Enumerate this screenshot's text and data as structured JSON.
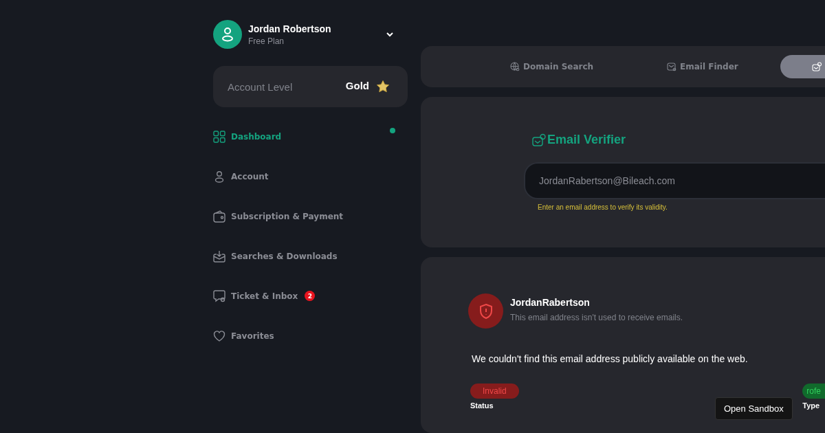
{
  "user": {
    "name": "Jordan Robertson",
    "plan": "Free Plan"
  },
  "account_level": {
    "label": "Account Level",
    "value": "Gold"
  },
  "sidebar": {
    "items": [
      {
        "label": "Dashboard",
        "selected": true
      },
      {
        "label": "Account",
        "selected": false
      },
      {
        "label": "Subscription & Payment",
        "selected": false
      },
      {
        "label": "Searches & Downloads",
        "selected": false
      },
      {
        "label": "Ticket & Inbox",
        "selected": false,
        "badge": "2"
      },
      {
        "label": "Favorites",
        "selected": false
      }
    ]
  },
  "tabs": [
    {
      "label": "Domain Search",
      "selected": false
    },
    {
      "label": "Email Finder",
      "selected": false
    },
    {
      "selected": true
    }
  ],
  "verifier": {
    "title": "Email Verifier",
    "value": "JordanRabertson@Bileach.com",
    "hint": "Enter an email address to verify its validity."
  },
  "result": {
    "name": "JordanRabertson",
    "subtitle": "This email address isn't used to receive emails.",
    "message": "We couldn't find this email address publicly available on the web.",
    "fields": [
      {
        "badge": "Invalid",
        "kind": "bad",
        "label": "Status"
      },
      {
        "badge": "rofe",
        "kind": "good",
        "label": "Type"
      }
    ]
  },
  "tooltip": "Open Sandbox"
}
